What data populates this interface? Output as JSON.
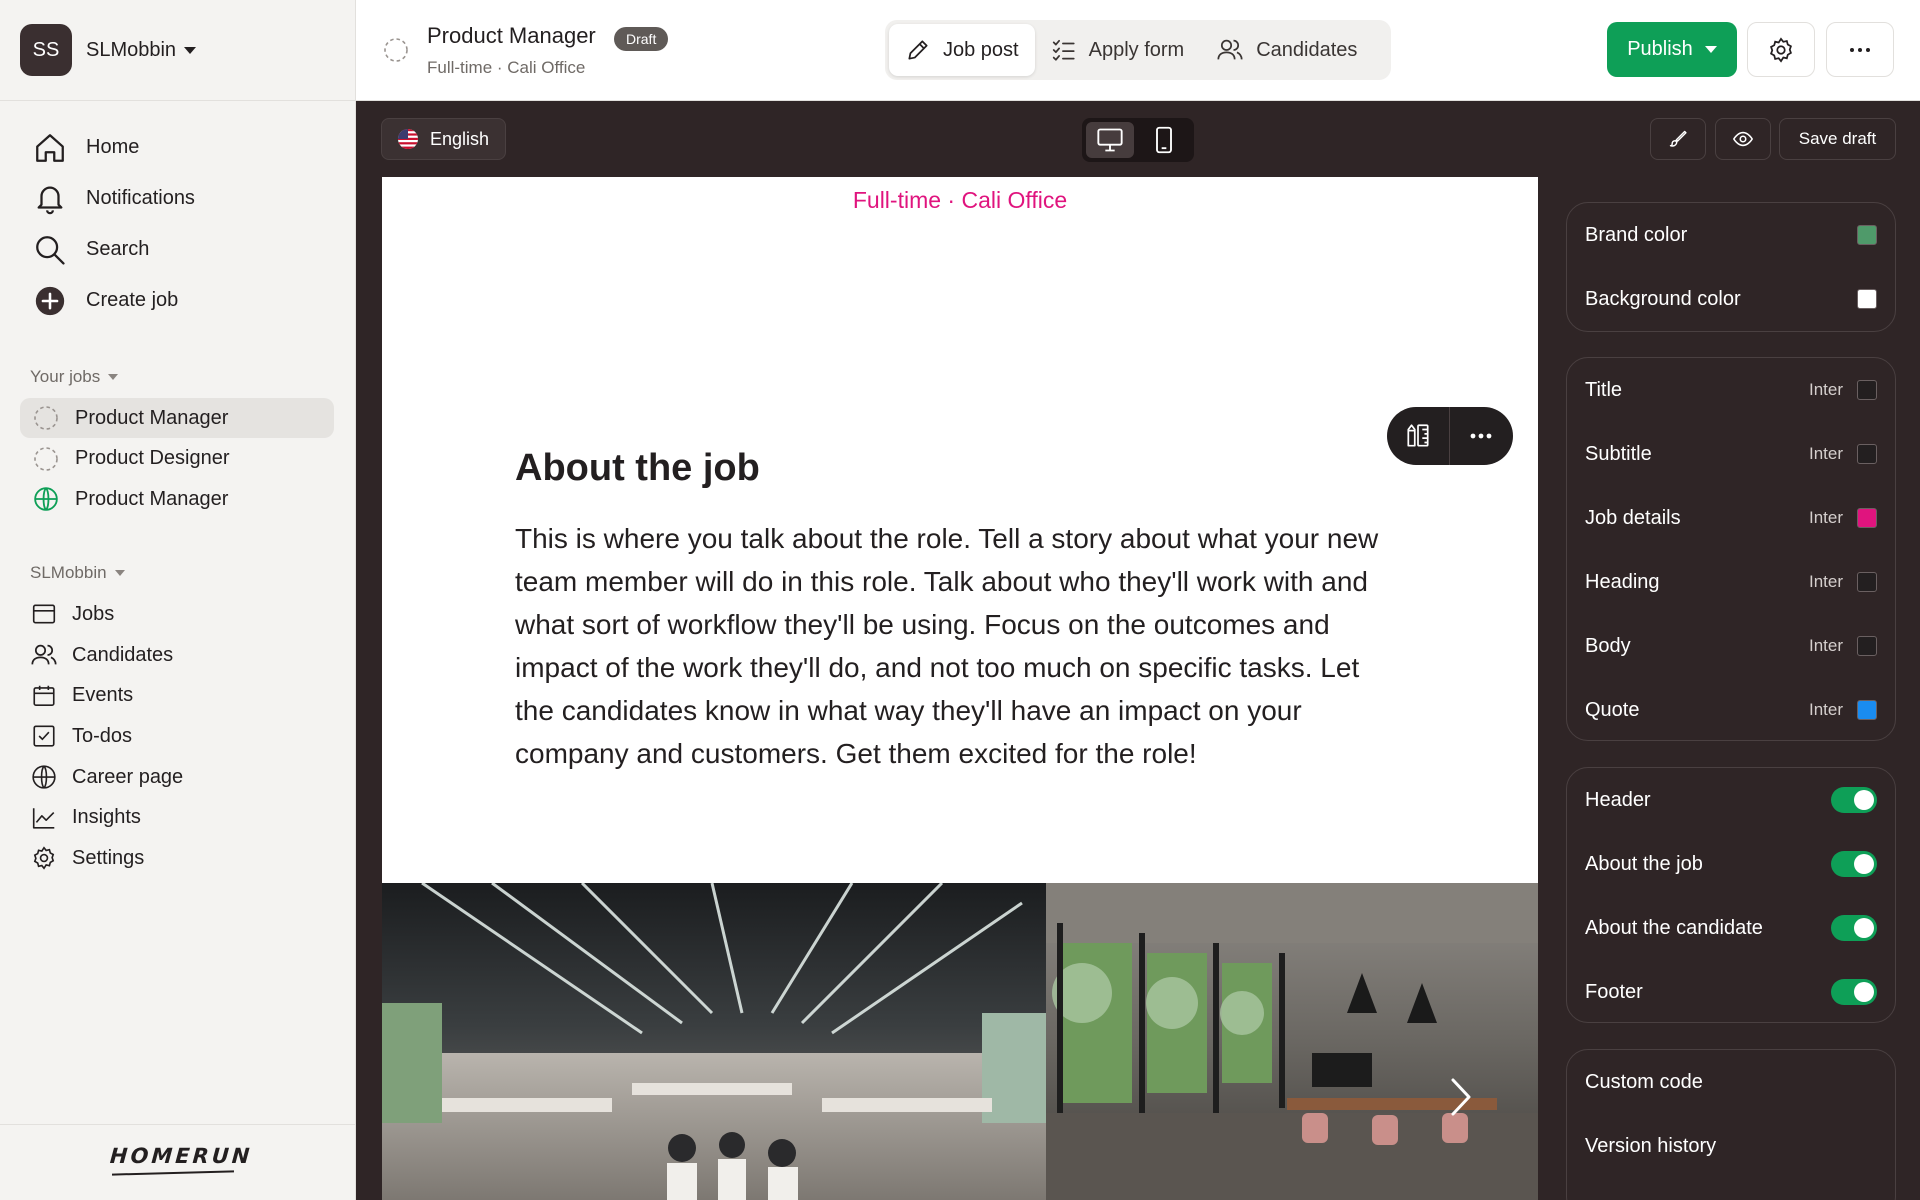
{
  "workspace": {
    "initials": "SS",
    "name": "SLMobbin"
  },
  "nav_main": [
    {
      "label": "Home",
      "icon": "home-icon"
    },
    {
      "label": "Notifications",
      "icon": "bell-icon"
    },
    {
      "label": "Search",
      "icon": "search-icon"
    },
    {
      "label": "Create job",
      "icon": "plus-circle-icon"
    }
  ],
  "your_jobs": {
    "heading": "Your jobs",
    "items": [
      {
        "label": "Product Manager",
        "status": "draft",
        "active": true
      },
      {
        "label": "Product Designer",
        "status": "draft",
        "active": false
      },
      {
        "label": "Product Manager",
        "status": "published",
        "active": false
      }
    ]
  },
  "org": {
    "heading": "SLMobbin",
    "items": [
      {
        "label": "Jobs",
        "icon": "jobs-icon"
      },
      {
        "label": "Candidates",
        "icon": "users-icon"
      },
      {
        "label": "Events",
        "icon": "calendar-icon"
      },
      {
        "label": "To-dos",
        "icon": "checkbox-icon"
      },
      {
        "label": "Career page",
        "icon": "globe-icon"
      },
      {
        "label": "Insights",
        "icon": "chart-icon"
      },
      {
        "label": "Settings",
        "icon": "gear-icon"
      }
    ]
  },
  "brand_logo": "HOMERUN",
  "header": {
    "title": "Product Manager",
    "badge": "Draft",
    "subtitle": "Full-time · Cali Office",
    "tabs": [
      {
        "label": "Job post",
        "icon": "pencil-icon",
        "active": true
      },
      {
        "label": "Apply form",
        "icon": "list-check-icon",
        "active": false
      },
      {
        "label": "Candidates",
        "icon": "users-icon",
        "active": false
      }
    ],
    "publish_label": "Publish"
  },
  "toolbar": {
    "language": "English",
    "save_draft": "Save draft"
  },
  "editor": {
    "meta": "Full-time · Cali Office",
    "section_heading": "About the job",
    "section_body": "This is where you talk about the role. Tell a story about what your new team member will do in this role. Talk about who they'll work with and what sort of workflow they'll be using. Focus on the outcomes and impact of the work they'll do, and not too much on specific tasks. Let the candidates know in what way they'll have an impact on your company and customers. Get them excited for the role!"
  },
  "design_panel": {
    "colors": [
      {
        "label": "Brand color",
        "color": "#4f9a6a"
      },
      {
        "label": "Background color",
        "color": "#ffffff"
      }
    ],
    "typography": [
      {
        "label": "Title",
        "font": "Inter",
        "color": "#231f20"
      },
      {
        "label": "Subtitle",
        "font": "Inter",
        "color": "#231f20"
      },
      {
        "label": "Job details",
        "font": "Inter",
        "color": "#e0147e"
      },
      {
        "label": "Heading",
        "font": "Inter",
        "color": "#231f20"
      },
      {
        "label": "Body",
        "font": "Inter",
        "color": "#231f20"
      },
      {
        "label": "Quote",
        "font": "Inter",
        "color": "#1a8cf0"
      }
    ],
    "sections": [
      {
        "label": "Header",
        "enabled": true
      },
      {
        "label": "About the job",
        "enabled": true
      },
      {
        "label": "About the candidate",
        "enabled": true
      },
      {
        "label": "Footer",
        "enabled": true
      }
    ],
    "links": [
      {
        "label": "Custom code"
      },
      {
        "label": "Version history"
      }
    ]
  },
  "colors": {
    "accent_green": "#0e9f57",
    "job_details_pink": "#e0147e",
    "editor_dark": "#2f2526"
  }
}
